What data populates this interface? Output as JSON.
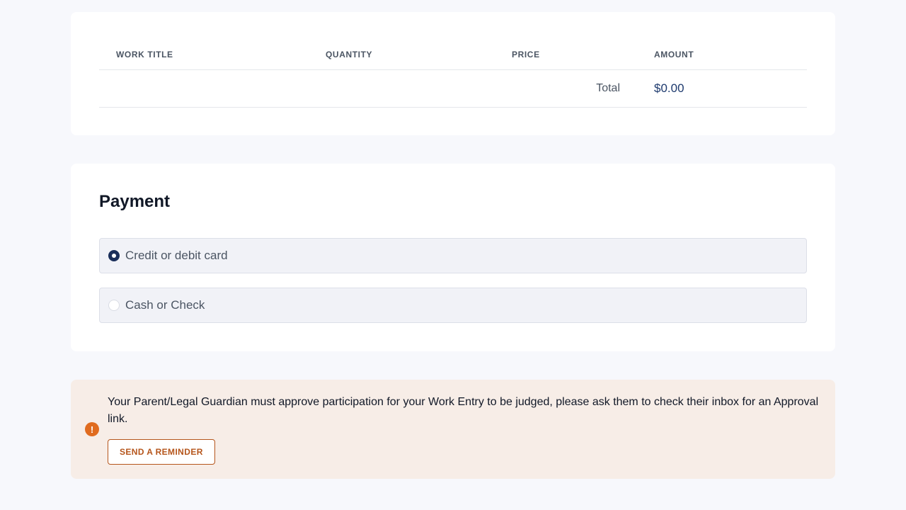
{
  "order_table": {
    "columns": [
      "WORK TITLE",
      "QUANTITY",
      "PRICE",
      "AMOUNT"
    ],
    "total_label": "Total",
    "total_value": "$0.00"
  },
  "payment": {
    "title": "Payment",
    "options": [
      {
        "label": "Credit or debit card",
        "selected": true
      },
      {
        "label": "Cash or Check",
        "selected": false
      }
    ]
  },
  "alert": {
    "icon": "exclamation-icon",
    "message": "Your Parent/Legal Guardian must approve participation for your Work Entry to be judged, please ask them to check their inbox for an Approval link.",
    "button_label": "SEND A REMINDER",
    "accent_color": "#e06b1f"
  }
}
